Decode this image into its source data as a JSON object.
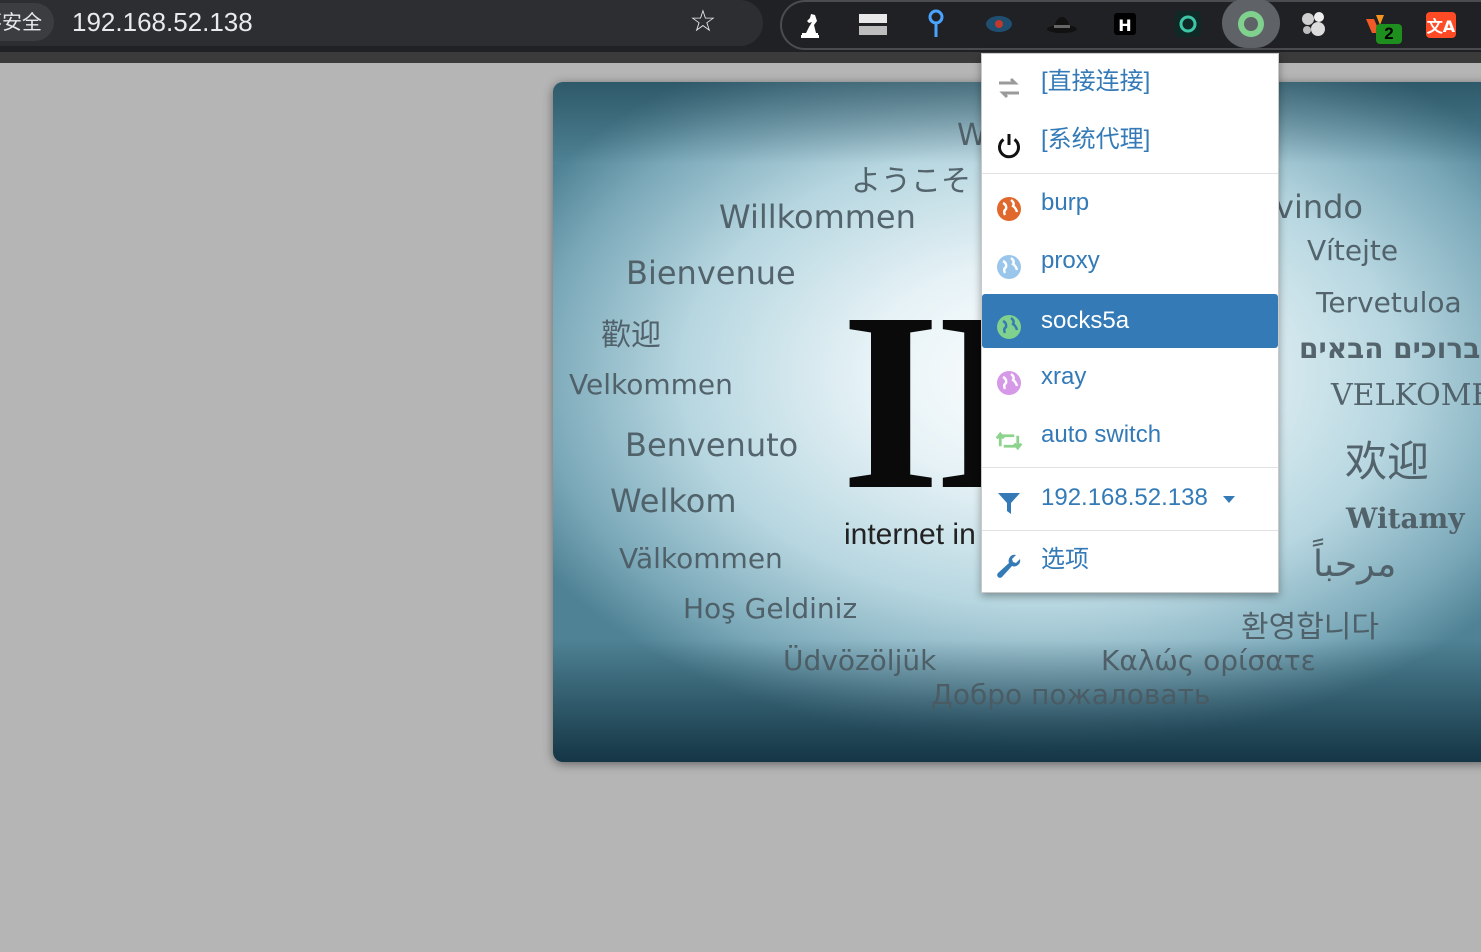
{
  "browser": {
    "security_label": "不安全",
    "url": "192.168.52.138",
    "bookmark_icon": "star-icon"
  },
  "extensions": [
    {
      "name": "chess-knight-extension-icon"
    },
    {
      "name": "bars-extension-icon"
    },
    {
      "name": "pin-extension-icon"
    },
    {
      "name": "eye-extension-icon"
    },
    {
      "name": "hat-extension-icon"
    },
    {
      "name": "h-extension-icon"
    },
    {
      "name": "circle-extension-icon"
    },
    {
      "name": "switchyomega-extension-icon"
    },
    {
      "name": "dots-extension-icon"
    },
    {
      "name": "wappalyzer-extension-icon",
      "badge": "2"
    },
    {
      "name": "translate-extension-icon"
    }
  ],
  "welcome_page": {
    "mark": "II",
    "tagline": "internet in",
    "words": {
      "w1": "W",
      "w2": "ようこそ",
      "w3": "Willkommen",
      "w4": "Bienvenue",
      "w5": "歡迎",
      "w6": "Velkommen",
      "w7": "Benvenuto",
      "w8": "Welkom",
      "w9": "Välkommen",
      "w10": "Hoş Geldiniz",
      "w11": "Üdvözöljük",
      "w12": "Добро пожаловать",
      "w13": "Καλώς ορίσατε",
      "w14": "환영합니다",
      "w15": "مرحباً",
      "w16": "Witamy",
      "w17": "欢迎",
      "w18": "VELKOMEN",
      "w19": "ברוכים הבאים",
      "w20": "Tervetuloa",
      "w21": "Vítejte",
      "w22": "vindo"
    }
  },
  "proxy_menu": {
    "direct": "[直接连接]",
    "system": "[系统代理]",
    "profiles": [
      {
        "label": "burp",
        "color": "#e0682c"
      },
      {
        "label": "proxy",
        "color": "#99c6ea"
      },
      {
        "label": "socks5a",
        "color": "#7fd18d",
        "selected": true
      },
      {
        "label": "xray",
        "color": "#d699e8"
      },
      {
        "label": "auto switch",
        "color": "#8dd38d"
      }
    ],
    "condition": "192.168.52.138",
    "options": "选项",
    "link_color": "#337ab7"
  }
}
